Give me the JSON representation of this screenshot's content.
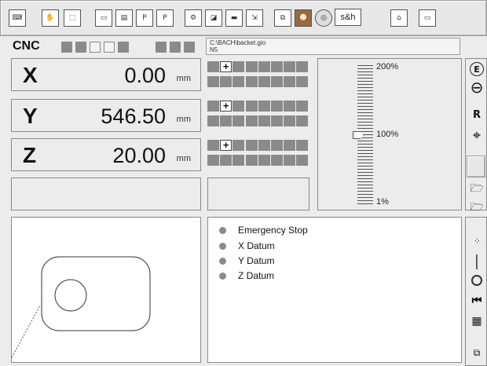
{
  "toolbar": {
    "icons": [
      "keyboard-icon",
      "hand-icon",
      "frame-icon",
      "screen-icon",
      "document-icon",
      "plc-icon",
      "plc-page-icon",
      "machine-icon",
      "disk-icon",
      "printer-icon",
      "export-icon",
      "network-icon",
      "operator-icon",
      "cd-icon",
      "bell-icon",
      "tape-icon"
    ],
    "sh_label": "s&h"
  },
  "status_bar": {
    "cnc_label": "CNC",
    "file_path": "C:\\BACH\\backet.gio",
    "block": "N5"
  },
  "axes": [
    {
      "label": "X",
      "value": "0.00",
      "unit": "mm"
    },
    {
      "label": "Y",
      "value": "546.50",
      "unit": "mm"
    },
    {
      "label": "Z",
      "value": "20.00",
      "unit": "mm"
    }
  ],
  "feed": {
    "max_label": "200%",
    "mid_label": "100%",
    "min_label": "1%",
    "override_fraction": 0.5
  },
  "right_buttons": {
    "e_label": "E",
    "r_label": "R"
  },
  "status": [
    {
      "label": "Emergency Stop"
    },
    {
      "label": "X Datum"
    },
    {
      "label": "Y Datum"
    },
    {
      "label": "Z Datum"
    }
  ],
  "colors": {
    "indicator_off": "#8a8a8a",
    "panel_bg": "#ececec"
  }
}
